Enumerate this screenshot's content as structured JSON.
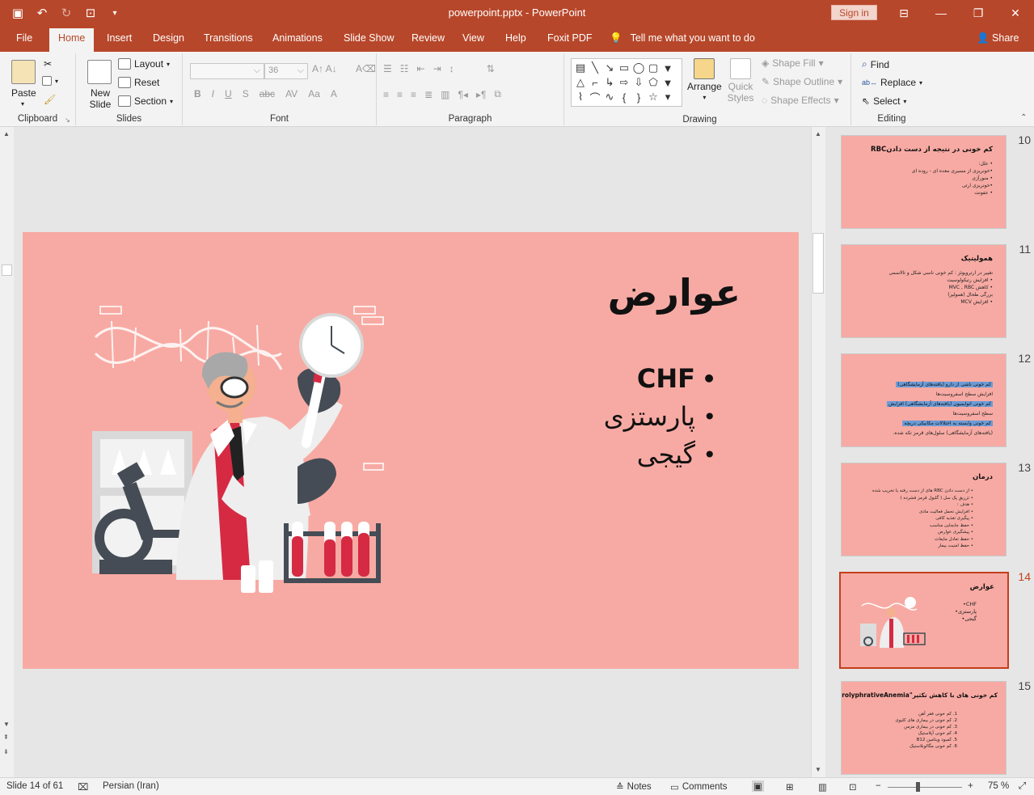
{
  "window": {
    "title": "powerpoint.pptx  -  PowerPoint",
    "signin": "Sign in"
  },
  "tabs": [
    "File",
    "Home",
    "Insert",
    "Design",
    "Transitions",
    "Animations",
    "Slide Show",
    "Review",
    "View",
    "Help",
    "Foxit PDF"
  ],
  "active_tab": "Home",
  "tellme": "Tell me what you want to do",
  "share": "Share",
  "ribbon": {
    "clipboard": {
      "label": "Clipboard",
      "paste": "Paste"
    },
    "slides": {
      "label": "Slides",
      "new_slide": "New Slide",
      "layout": "Layout",
      "reset": "Reset",
      "section": "Section"
    },
    "font": {
      "label": "Font",
      "size": "36"
    },
    "paragraph": {
      "label": "Paragraph"
    },
    "drawing": {
      "label": "Drawing",
      "arrange": "Arrange",
      "quick_styles": "Quick Styles",
      "shape_fill": "Shape Fill",
      "shape_outline": "Shape Outline",
      "shape_effects": "Shape Effects"
    },
    "editing": {
      "label": "Editing",
      "find": "Find",
      "replace": "Replace",
      "select": "Select"
    }
  },
  "slide": {
    "title": "عوارض",
    "bullets": [
      "CHF",
      "پارستزی",
      "گیجی"
    ]
  },
  "thumbnails": [
    {
      "num": "10",
      "title": "کم خونی در نتیجه از دست دادنRBC",
      "lines": [
        "• علل:",
        "•خونریزی از مسیری معده ای - روده ای",
        "• منورآژی",
        "•خونریزی ارثی",
        "• عفونت"
      ]
    },
    {
      "num": "11",
      "title": "همولیتیک",
      "lines": [
        "تغییر در ارتروپوئز : کم خونی ناسی شکل و تالاسمی",
        "• افزایش رتیکولوسیت",
        "• کاهش MVC , RBC",
        "بزرگی طحال (همولیز)",
        "• افزایش MCV"
      ]
    },
    {
      "num": "12",
      "title": "",
      "lines": [
        "کم خونی ناشی از دارو (یافته‌های آزمایشگاهی)",
        "افزایش سطح اسفروسیت‌ها",
        "کم خونی اتوایمیون (یافته‌های آزمایشگاهی) افزایش",
        "سطح اسفروسیت‌ها",
        "کم خونی وابسته به اختلالات مکانیکی دریچه",
        "(یافته‌های آزمایشگاهی) سلول‌های قرمز تکه شده."
      ]
    },
    {
      "num": "13",
      "title": "درمان",
      "lines": [
        "• از دست دادن RBC های از دست رفته یا تخریب شده",
        "• تزریق پک سل ( گلبول قرمز فشرده )",
        "• هدف :",
        "• افزایش تحمل فعالیت مادی",
        "• پیگیری تغذیه کافی",
        "• حفظ جابجایی مناسب",
        "• پیشگیری عوارض",
        "• حفظ تعادل مایعات",
        "• حفظ امنیت بیمار"
      ]
    },
    {
      "num": "14",
      "title": "عوارض",
      "lines": [
        "CHF•",
        "پارستزی•",
        "گیجی•"
      ]
    },
    {
      "num": "15",
      "title": "کم خونی های با کاهش تکثیر\"HypoprolyphrativeAnemia\"",
      "lines": [
        "1. کم خونی فقر آهن",
        "2. کم خونی در بیماری های کلیوی",
        "3. کم خونی در بیماری مزمن",
        "4. کم خونی آپلاستیک",
        "5. کمبود ویتامین B12",
        "6. کم خونی مگالوبلاستیک"
      ]
    }
  ],
  "status": {
    "slide_info": "Slide 14 of 61",
    "language": "Persian (Iran)",
    "notes": "Notes",
    "comments": "Comments",
    "zoom": "75 %"
  }
}
